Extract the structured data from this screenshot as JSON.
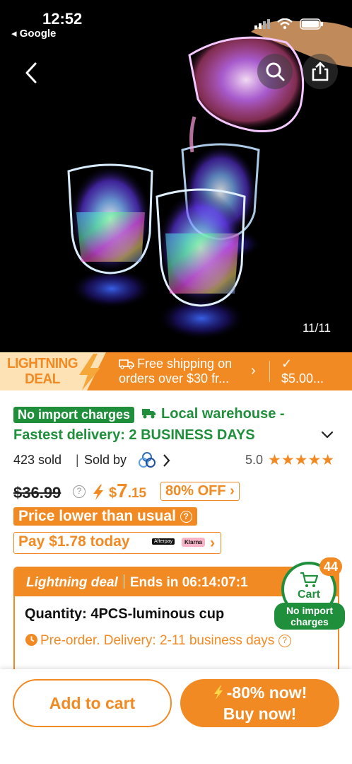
{
  "status_bar": {
    "time": "12:52",
    "back_app": "Google"
  },
  "hero": {
    "image_counter": "11/11",
    "icons": [
      "back-arrow-icon",
      "search-icon",
      "share-icon"
    ]
  },
  "banner": {
    "title_line1": "LIGHTNING",
    "title_line2": "DEAL",
    "shipping_line1": "Free shipping on",
    "shipping_line2": "orders over $30 fr...",
    "check_line2": "$5.00..."
  },
  "shipping": {
    "badge": "No import charges",
    "local_line1": "Local warehouse -",
    "local_line2": "Fastest delivery: 2 BUSINESS DAYS"
  },
  "stats": {
    "sold": "423 sold",
    "sold_by": "Sold by",
    "rating": "5.0",
    "stars": "★★★★★"
  },
  "price": {
    "original": "$36.99",
    "currency": "$",
    "integer": "7",
    "decimal": ".15",
    "discount": "80% OFF",
    "lower_than_usual": "Price lower than usual",
    "pay_today": "Pay $1.78 today",
    "afterpay": "Afterpay",
    "klarna": "Klarna"
  },
  "deal": {
    "label": "Lightning deal",
    "ends": "Ends in 06:14:07:1",
    "quantity": "Quantity: 4PCS-luminous cup",
    "preorder": "Pre-order. Delivery: 2-11 business days"
  },
  "cart": {
    "label": "Cart",
    "count": "44",
    "note_line1": "No import",
    "note_line2": "charges"
  },
  "actions": {
    "add_to_cart": "Add to cart",
    "buy_line1": "-80% now!",
    "buy_line2": "Buy now!"
  },
  "colors": {
    "accent": "#f28a23",
    "green": "#1f8f3c",
    "banner_light": "#fde2b6"
  }
}
